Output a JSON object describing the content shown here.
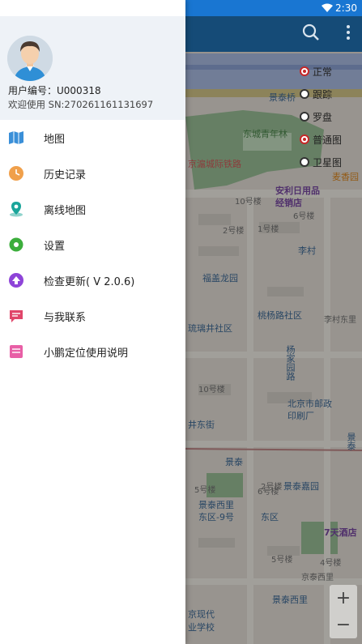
{
  "status": {
    "time": "2:30",
    "wifi_icon": "wifi-icon"
  },
  "drawer": {
    "user_id": "用户编号：U000318",
    "welcome": "欢迎使用 SN:270261161131697",
    "items": [
      {
        "label": "地图",
        "icon": "map-icon",
        "color": "#3a8fd8"
      },
      {
        "label": "历史记录",
        "icon": "clock-icon",
        "color": "#f0a04b"
      },
      {
        "label": "离线地图",
        "icon": "location-pin-icon",
        "color": "#1aa59a"
      },
      {
        "label": "设置",
        "icon": "gear-icon",
        "color": "#3cae3c"
      },
      {
        "label": "检查更新( V 2.0.6)",
        "icon": "arrow-up-icon",
        "color": "#8e44d8"
      },
      {
        "label": "与我联系",
        "icon": "chat-icon",
        "color": "#e0466a"
      },
      {
        "label": "小鹏定位使用说明",
        "icon": "document-icon",
        "color": "#e85fa6"
      }
    ]
  },
  "map_options": [
    {
      "label": "正常",
      "selected": true
    },
    {
      "label": "跟踪",
      "selected": false
    },
    {
      "label": "罗盘",
      "selected": false
    },
    {
      "label": "普通图",
      "selected": true
    },
    {
      "label": "卫星图",
      "selected": false
    }
  ],
  "map_labels": {
    "l1": "景泰桥",
    "l2": "东城青年林",
    "l3": "京滬城际铁路",
    "l4": "安利日用品",
    "l5": "经销店",
    "l6": "麦香园",
    "l7": "10号楼",
    "l8": "6号楼",
    "l9": "2号楼",
    "l10": "1号楼",
    "l11": "李村",
    "l12": "福盖龙园",
    "l13": "桃杨路社区",
    "l14": "琉璃井社区",
    "l15": "杨家园路",
    "l16": "李村东里",
    "l17": "北京市邮政",
    "l18": "印刷厂",
    "l19": "井东街",
    "l20": "景泰",
    "l21": "景泰嘉园",
    "l22": "景泰西里",
    "l23": "东区-9号",
    "l24": "东区",
    "l25": "7天酒店",
    "l26": "景泰西里",
    "l27": "京现代",
    "l28": "业学校",
    "l29": "5号楼",
    "l30": "6号楼",
    "l31": "4号楼",
    "l32": "2号楼",
    "l33": "5号楼",
    "l34": "京泰西里",
    "l35": "10号楼",
    "l36": "景泰",
    "l37": "跟踪"
  },
  "zoom": {
    "plus": "+",
    "minus": "−"
  }
}
